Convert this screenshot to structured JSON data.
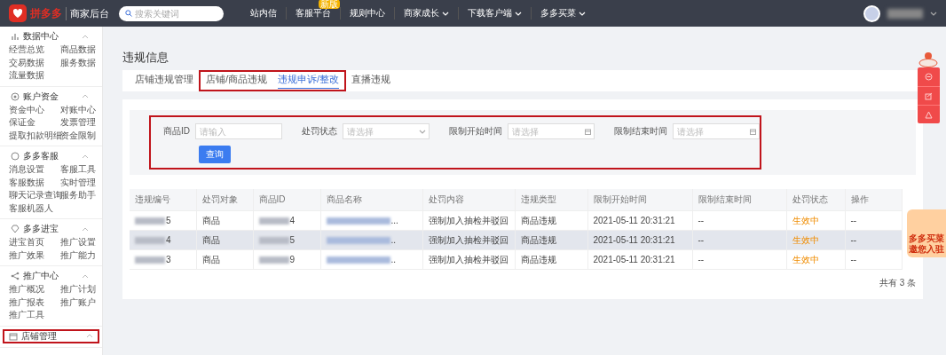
{
  "topbar": {
    "brand": "拼多多",
    "subtitle": "商家后台",
    "search": {
      "placeholder": "搜索关键词"
    },
    "nav": [
      {
        "label": "站内信",
        "dropdown": false
      },
      {
        "label": "客服平台",
        "dropdown": false,
        "badge": "新版"
      },
      {
        "label": "规则中心",
        "dropdown": false
      },
      {
        "label": "商家成长",
        "dropdown": true
      },
      {
        "label": "下载客户端",
        "dropdown": true
      },
      {
        "label": "多多买菜",
        "dropdown": true
      }
    ]
  },
  "sidebar": {
    "groups": [
      {
        "title": "数据中心",
        "highlighted": false,
        "items": [
          "经营总览",
          "商品数据",
          "交易数据",
          "服务数据",
          "流量数据"
        ]
      },
      {
        "title": "账户资金",
        "highlighted": false,
        "items": [
          "资金中心",
          "对账中心",
          "保证金",
          "发票管理",
          "提取扣款明细",
          "资金限制"
        ]
      },
      {
        "title": "多多客服",
        "highlighted": false,
        "items": [
          "消息设置",
          "客服工具",
          "客服数据",
          "实时管理",
          "聊天记录查询",
          "服务助手",
          "客服机器人"
        ]
      },
      {
        "title": "多多进宝",
        "highlighted": false,
        "items": [
          "进宝首页",
          "推广设置",
          "推广效果",
          "推广能力"
        ]
      },
      {
        "title": "推广中心",
        "highlighted": false,
        "items": [
          "推广概况",
          "推广计划",
          "推广报表",
          "推广账户",
          "推广工具"
        ]
      },
      {
        "title": "店铺管理",
        "highlighted": true
      }
    ]
  },
  "page": {
    "title": "违规信息",
    "tabs": [
      {
        "label": "店铺违规管理",
        "selected": false,
        "highlighted": false
      },
      {
        "label": "店铺/商品违规",
        "selected": false,
        "highlighted": true
      },
      {
        "label": "违规申诉/整改",
        "selected": true,
        "highlighted": true
      },
      {
        "label": "直播违规",
        "selected": false,
        "highlighted": false
      }
    ],
    "filters": {
      "highlighted": true,
      "fields": [
        {
          "label": "商品ID",
          "kind": "input",
          "placeholder": "请输入"
        },
        {
          "label": "处罚状态",
          "kind": "select",
          "placeholder": "请选择"
        },
        {
          "label": "限制开始时间",
          "kind": "date",
          "placeholder": "请选择"
        },
        {
          "label": "限制结束时间",
          "kind": "date",
          "placeholder": "请选择"
        }
      ],
      "button": "查询"
    },
    "table": {
      "columns": [
        "违规编号",
        "处罚对象",
        "商品ID",
        "商品名称",
        "处罚内容",
        "违规类型",
        "限制开始时间",
        "限制结束时间",
        "处罚状态",
        "操作"
      ],
      "rows": [
        {
          "selected": false,
          "cells": [
            "5",
            "商品",
            "4",
            "...",
            "强制加入抽检并驳回",
            "商品违规",
            "2021-05-11 20:31:21",
            "--",
            "生效中",
            "--"
          ]
        },
        {
          "selected": true,
          "cells": [
            "4",
            "商品",
            "5",
            "..",
            "强制加入抽检并驳回",
            "商品违规",
            "2021-05-11 20:31:21",
            "--",
            "生效中",
            "--"
          ]
        },
        {
          "selected": false,
          "cells": [
            "3",
            "商品",
            "9",
            "..",
            "强制加入抽检并驳回",
            "商品违规",
            "2021-05-11 20:31:21",
            "--",
            "生效中",
            "--"
          ]
        }
      ]
    },
    "total": "共有 3 条"
  },
  "promo": [
    "多多买菜",
    "邀您入驻"
  ]
}
